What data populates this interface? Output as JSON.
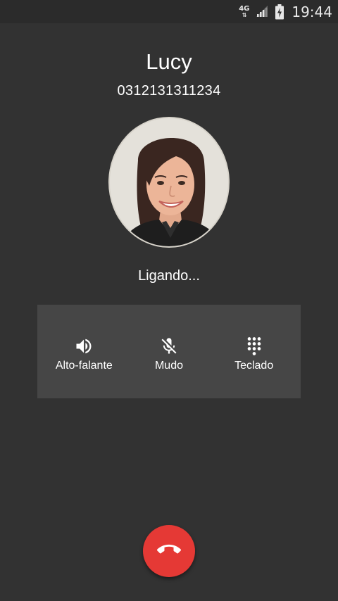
{
  "status_bar": {
    "network_type": "4G",
    "network_arrows": "⇅",
    "time": "19:44",
    "signal_icon": "cell-signal-icon",
    "battery_icon": "battery-charging-icon"
  },
  "caller": {
    "name": "Lucy",
    "number": "0312131311234",
    "avatar_icon": "contact-photo"
  },
  "call_status": "Ligando...",
  "actions": [
    {
      "label": "Alto-falante",
      "icon": "speaker-icon"
    },
    {
      "label": "Mudo",
      "icon": "mic-off-icon"
    },
    {
      "label": "Teclado",
      "icon": "dialpad-icon"
    }
  ],
  "end_call": {
    "icon": "end-call-icon"
  },
  "colors": {
    "background": "#323232",
    "panel": "#464646",
    "end_call": "#e53935"
  }
}
